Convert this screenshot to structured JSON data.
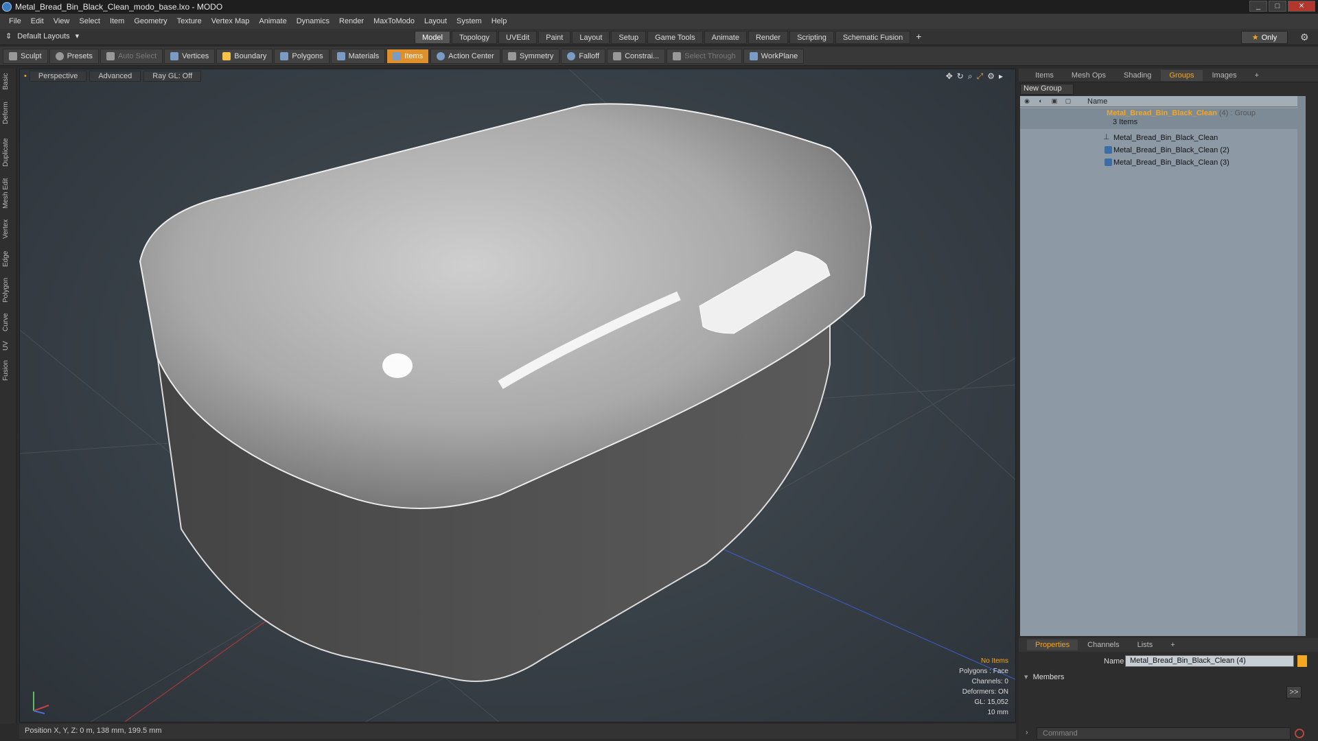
{
  "window": {
    "title": "Metal_Bread_Bin_Black_Clean_modo_base.lxo - MODO",
    "controls": [
      "_",
      "□",
      "✕"
    ]
  },
  "menu": [
    "File",
    "Edit",
    "View",
    "Select",
    "Item",
    "Geometry",
    "Texture",
    "Vertex Map",
    "Animate",
    "Dynamics",
    "Render",
    "MaxToModo",
    "Layout",
    "System",
    "Help"
  ],
  "layout": {
    "label": "Default Layouts",
    "tabs": [
      "Model",
      "Topology",
      "UVEdit",
      "Paint",
      "Layout",
      "Setup",
      "Game Tools",
      "Animate",
      "Render",
      "Scripting",
      "Schematic Fusion"
    ],
    "active_tab": "Model",
    "plus": "+",
    "only_label": "Only"
  },
  "toolbar": {
    "sculpt": "Sculpt",
    "presets": "Presets",
    "auto_select": "Auto Select",
    "vertices": "Vertices",
    "boundary": "Boundary",
    "polygons": "Polygons",
    "materials": "Materials",
    "items": "Items",
    "action_center": "Action Center",
    "symmetry": "Symmetry",
    "falloff": "Falloff",
    "constraints": "Constrai...",
    "select_through": "Select Through",
    "workplane": "WorkPlane"
  },
  "left_tabs": [
    "Basic",
    "Deform",
    "Duplicate",
    "Mesh Edit",
    "Vertex",
    "Edge",
    "Polygon",
    "Curve",
    "UV",
    "Fusion"
  ],
  "viewport": {
    "view": "Perspective",
    "mode": "Advanced",
    "raygl": "Ray GL: Off",
    "info": {
      "items": "No Items",
      "polygons": "Polygons : Face",
      "channels": "Channels: 0",
      "deformers": "Deformers: ON",
      "gl": "GL: 15,052",
      "scale": "10 mm"
    }
  },
  "status": {
    "position": "Position X, Y, Z:  0 m, 138 mm, 199.5 mm"
  },
  "right_panel": {
    "tabs": [
      "Items",
      "Mesh Ops",
      "Shading",
      "Groups",
      "Images"
    ],
    "active_tab": "Groups",
    "new_group": "New Group",
    "name_header": "Name",
    "group": {
      "name": "Metal_Bread_Bin_Black_Clean",
      "suffix": " (4) : Group",
      "count": "3 Items"
    },
    "items": [
      "Metal_Bread_Bin_Black_Clean",
      "Metal_Bread_Bin_Black_Clean (2)",
      "Metal_Bread_Bin_Black_Clean (3)"
    ]
  },
  "properties": {
    "tabs": [
      "Properties",
      "Channels",
      "Lists"
    ],
    "active_tab": "Properties",
    "name_label": "Name",
    "name_value": "Metal_Bread_Bin_Black_Clean (4)",
    "members": "Members",
    "forward": ">>"
  },
  "command": {
    "placeholder": "Command"
  },
  "colors": {
    "accent": "#f5a623",
    "active_tool": "#e0902a",
    "list_bg": "#8d9aa5"
  }
}
